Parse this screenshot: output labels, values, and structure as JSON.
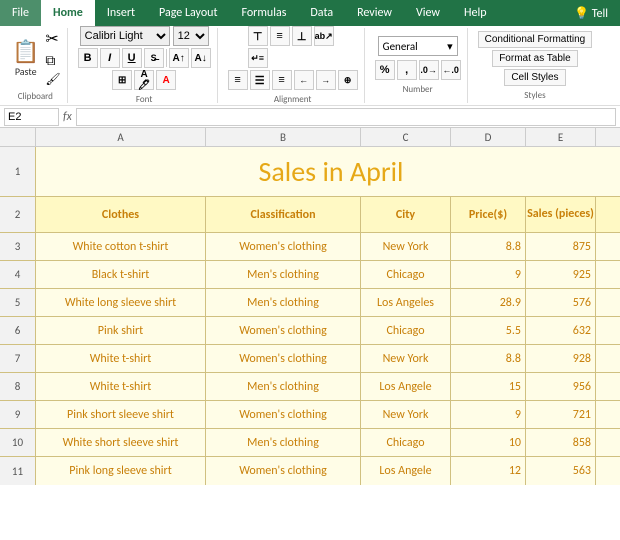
{
  "tabs": [
    "File",
    "Home",
    "Insert",
    "Page Layout",
    "Formulas",
    "Data",
    "Review",
    "View",
    "Help"
  ],
  "active_tab": "Home",
  "toolbar": {
    "clipboard_label": "Clipboard",
    "font_label": "Font",
    "alignment_label": "Alignment",
    "number_label": "Number",
    "styles_label": "Styles",
    "font_name": "Calibri Light",
    "font_size": "12",
    "bold": "B",
    "italic": "I",
    "underline": "U",
    "number_format": "General",
    "cond_format": "Conditional Formatting",
    "format_table": "Format as Table",
    "cell_styles": "Cell Styles"
  },
  "formula_bar": {
    "cell_ref": "E2",
    "fx": "fx",
    "formula": ""
  },
  "columns": {
    "row_header": "",
    "a": "A",
    "b": "B",
    "c": "C",
    "d": "D",
    "e": "E"
  },
  "title": {
    "row": "1",
    "text": "Sales in April"
  },
  "headers": {
    "row": "2",
    "clothes": "Clothes",
    "classification": "Classification",
    "city": "City",
    "price": "Price($)",
    "sales": "Sales (pieces)"
  },
  "rows": [
    {
      "row": "3",
      "clothes": "White cotton t-shirt",
      "classification": "Women's clothing",
      "city": "New York",
      "price": "8.8",
      "sales": "875"
    },
    {
      "row": "4",
      "clothes": "Black t-shirt",
      "classification": "Men's clothing",
      "city": "Chicago",
      "price": "9",
      "sales": "925"
    },
    {
      "row": "5",
      "clothes": "White long sleeve shirt",
      "classification": "Men's clothing",
      "city": "Los Angeles",
      "price": "28.9",
      "sales": "576"
    },
    {
      "row": "6",
      "clothes": "Pink shirt",
      "classification": "Women's clothing",
      "city": "Chicago",
      "price": "5.5",
      "sales": "632"
    },
    {
      "row": "7",
      "clothes": "White t-shirt",
      "classification": "Women's clothing",
      "city": "New York",
      "price": "8.8",
      "sales": "928"
    },
    {
      "row": "8",
      "clothes": "White t-shirt",
      "classification": "Men's clothing",
      "city": "Los Angele",
      "price": "15",
      "sales": "956"
    },
    {
      "row": "9",
      "clothes": "Pink short sleeve shirt",
      "classification": "Women's clothing",
      "city": "New York",
      "price": "9",
      "sales": "721"
    },
    {
      "row": "10",
      "clothes": "White short sleeve shirt",
      "classification": "Men's clothing",
      "city": "Chicago",
      "price": "10",
      "sales": "858"
    },
    {
      "row": "11",
      "clothes": "Pink long sleeve shirt",
      "classification": "Women's clothing",
      "city": "Los Angele",
      "price": "12",
      "sales": "563"
    }
  ]
}
